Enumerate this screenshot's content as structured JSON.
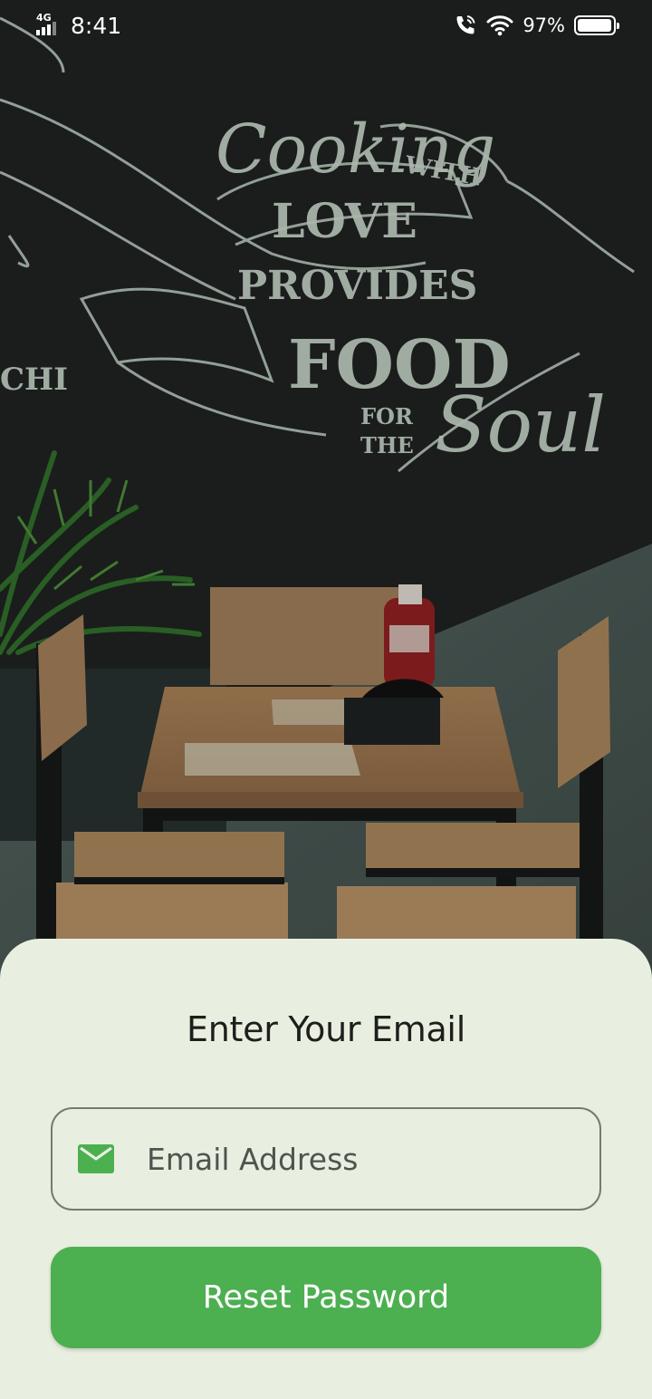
{
  "status_bar": {
    "network": "4G",
    "time": "8:41",
    "battery_percent": "97%",
    "battery_level": 0.97
  },
  "background": {
    "chalkboard_text": [
      "Cooking",
      "WITH",
      "LOVE",
      "PROVIDES",
      "FOOD",
      "FOR",
      "THE",
      "Soul",
      "CHI"
    ]
  },
  "form": {
    "title": "Enter Your Email",
    "email": {
      "value": "",
      "placeholder": "Email Address",
      "icon": "mail-icon"
    },
    "submit_label": "Reset Password"
  },
  "colors": {
    "accent": "#4caf50",
    "sheet_background": "#e9efe0",
    "mail_icon": "#4caf50"
  }
}
